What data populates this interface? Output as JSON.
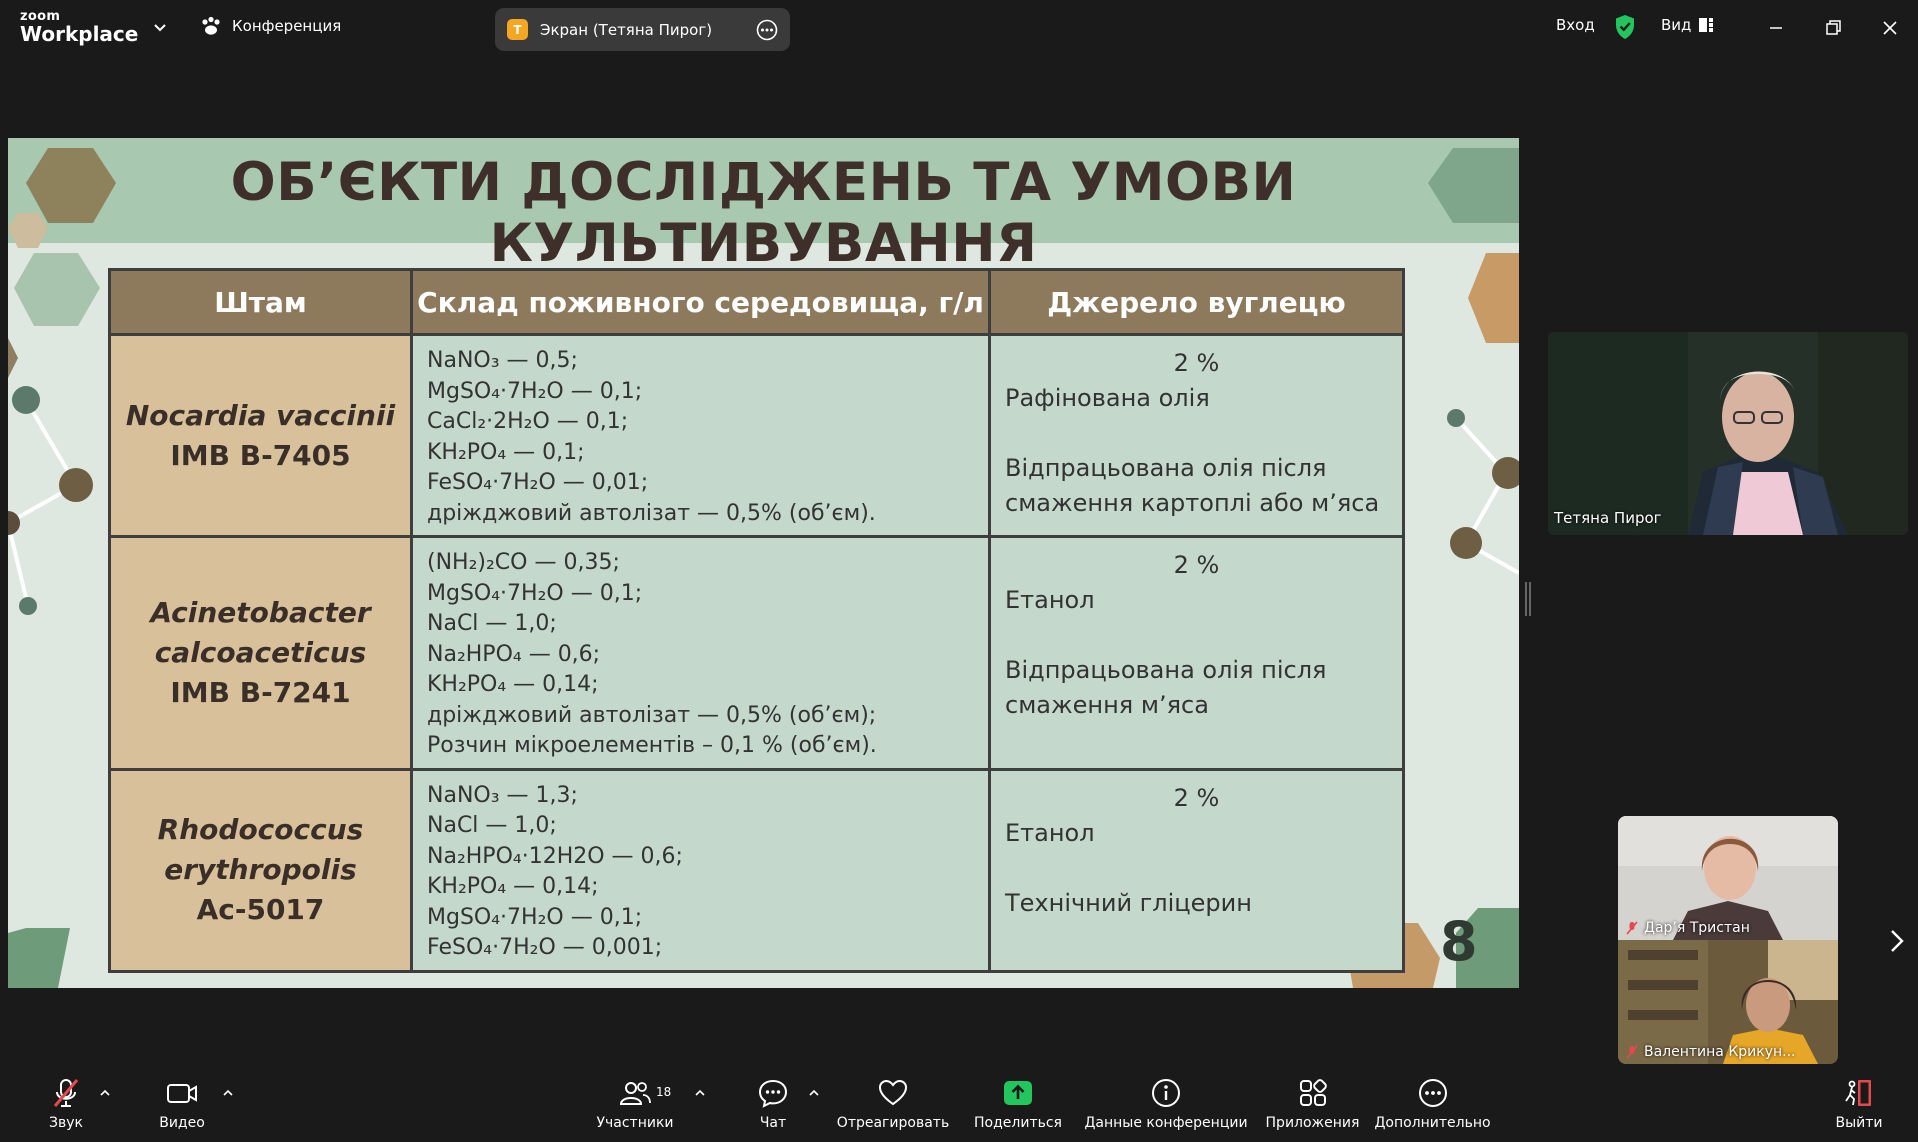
{
  "app": {
    "logo_top": "zoom",
    "logo_bottom": "Workplace"
  },
  "topbar": {
    "meeting_label": "Конференция",
    "share_badge": "Т",
    "share_title": "Экран (Тетяна Пирог)",
    "signin_label": "Вход",
    "view_label": "Вид"
  },
  "slide": {
    "title": "ОБ’ЄКТИ ДОСЛІДЖЕНЬ ТА УМОВИ КУЛЬТИВУВАННЯ",
    "headers": [
      "Штам",
      "Склад поживного середовища, г/л",
      "Джерело вуглецю"
    ],
    "page_number": "8",
    "rows": [
      {
        "strain_latin": [
          "Nocardia vaccinii"
        ],
        "strain_code": "IMB B-7405",
        "medium": [
          "NaNO₃ — 0,5;",
          "MgSO₄·7H₂O — 0,1;",
          "CaCl₂·2H₂O — 0,1;",
          "KH₂PO₄ — 0,1;",
          "FeSO₄·7H₂O — 0,01;",
          "дріжджовий автолізат — 0,5% (об’єм)."
        ],
        "carbon_pct": "2 %",
        "carbon_first": "Рафінована олія",
        "carbon_second": [
          "Відпрацьована олія після",
          "смаження картоплі або м’яса"
        ]
      },
      {
        "strain_latin": [
          "Acinetobacter",
          "calcoaceticus"
        ],
        "strain_code": "IMB B-7241",
        "medium": [
          "(NH₂)₂CO — 0,35;",
          "MgSO₄·7H₂O — 0,1;",
          "NaCl — 1,0;",
          "Na₂HPO₄ — 0,6;",
          "KH₂PO₄ — 0,14;",
          "дріжджовий автолізат — 0,5% (об’єм);",
          "Розчин мікроелементів – 0,1 % (об’єм)."
        ],
        "carbon_pct": "2 %",
        "carbon_first": "Етанол",
        "carbon_second": [
          "Відпрацьована олія після",
          "смаження м’яса"
        ]
      },
      {
        "strain_latin": [
          "Rhodococcus",
          "erythropolis"
        ],
        "strain_code": "Ac-5017",
        "medium": [
          "NaNO₃ — 1,3;",
          "NaCl — 1,0;",
          "Na₂HPO₄·12H2O — 0,6;",
          "KH₂PO₄ — 0,14;",
          "MgSO₄·7H₂O — 0,1;",
          "FeSO₄·7H₂O — 0,001;"
        ],
        "carbon_pct": "2 %",
        "carbon_first": "Етанол",
        "carbon_second": [
          "Технічний гліцерин"
        ]
      }
    ]
  },
  "participants": {
    "main_name": "Тетяна Пирог",
    "thumb1_name": "Дар’я Тристан",
    "thumb2_name": "Валентина Крикун..."
  },
  "toolbar": {
    "audio": "Звук",
    "video": "Видео",
    "participants": "Участники",
    "participants_count": "18",
    "chat": "Чат",
    "react": "Отреагировать",
    "share": "Поделиться",
    "info": "Данные конференции",
    "apps": "Приложения",
    "more": "Дополнительно",
    "leave": "Выйти"
  },
  "colors": {
    "share_green": "#22c55e",
    "leave_red": "#e5484d",
    "shield_green": "#22c55e",
    "badge_orange": "#f5a623"
  }
}
